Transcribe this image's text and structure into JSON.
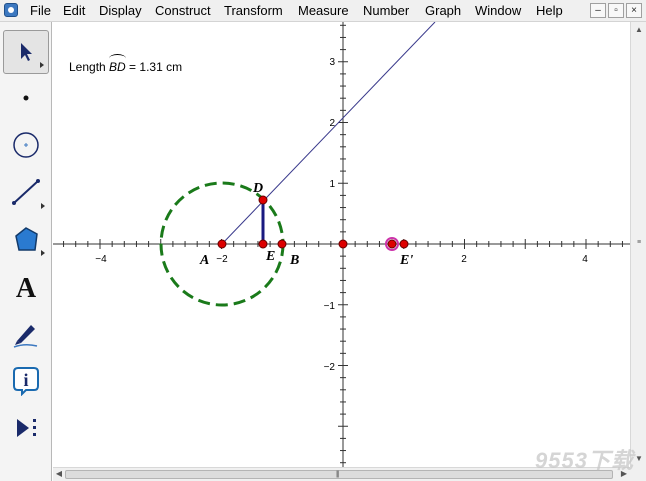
{
  "menu": {
    "items": [
      "File",
      "Edit",
      "Display",
      "Construct",
      "Transform",
      "Measure",
      "Number",
      "Graph",
      "Window",
      "Help"
    ]
  },
  "window_controls": {
    "minimize": "–",
    "restore": "▫",
    "close": "×"
  },
  "toolbox": {
    "tools": [
      "arrow-select-tool",
      "point-tool",
      "compass-tool",
      "straightedge-tool",
      "polygon-tool",
      "text-tool",
      "marker-tool",
      "information-tool",
      "custom-tool"
    ],
    "selected": "arrow-select-tool",
    "text_tool_glyph": "A",
    "info_tool_glyph": "i"
  },
  "measurement": {
    "prefix": "Length ",
    "arc_name": "BD",
    "suffix": " = 1.31 cm"
  },
  "axes": {
    "x_tick_labels": [
      "−4",
      "−2",
      "2",
      "4"
    ],
    "y_tick_labels": [
      "3",
      "2",
      "1",
      "−1",
      "−2"
    ]
  },
  "points": {
    "A": "A",
    "B": "B",
    "D": "D",
    "E": "E",
    "E_prime": "E'"
  },
  "colors": {
    "circle": "#1a7a1a",
    "line": "#3a3a8c",
    "segment": "#1a1a80",
    "point": "#dd0000",
    "selection": "#cc33aa"
  },
  "watermark": "9553下载"
}
